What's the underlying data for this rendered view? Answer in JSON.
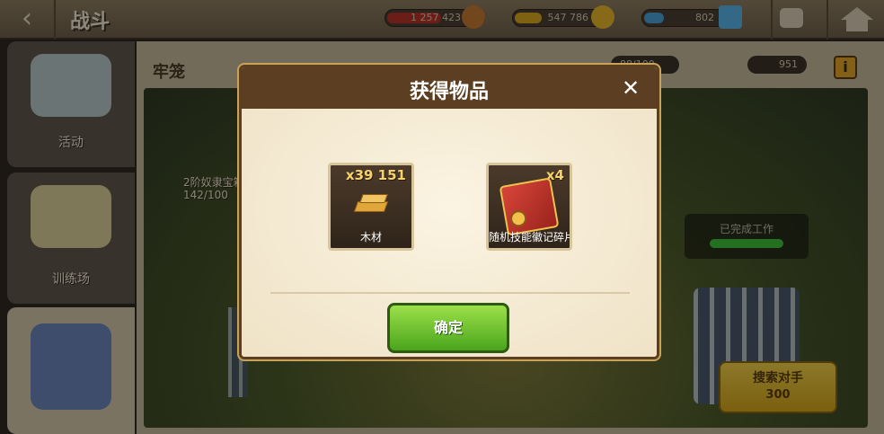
{
  "topbar": {
    "title": "战斗",
    "resources": [
      {
        "name": "meat",
        "value": "1 257 423",
        "color": "#b8322a",
        "icon": "meat-icon"
      },
      {
        "name": "gold",
        "value": "547 786",
        "color": "#d9a91f",
        "icon": "gold-coin-icon"
      },
      {
        "name": "gems",
        "value": "802",
        "color": "#4aa0d8",
        "icon": "gem-icon"
      }
    ]
  },
  "sidebar": {
    "items": [
      {
        "label": "活动",
        "icon": "event-icon"
      },
      {
        "label": "训练场",
        "icon": "training-icon"
      },
      {
        "label": "",
        "icon": "prison-icon"
      }
    ]
  },
  "main": {
    "title": "牢笼",
    "badge_left": "88/100",
    "badge_right": "951",
    "event_title": "2阶奴隶宝箱",
    "event_count": "142/100",
    "done_label": "已完成工作",
    "search_label": "搜索对手",
    "search_cost": "300"
  },
  "modal": {
    "title": "获得物品",
    "close_label": "✕",
    "items": [
      {
        "qty": "x39 151",
        "name": "木材",
        "icon": "wood-icon"
      },
      {
        "qty": "x4",
        "name": "随机技能徽记碎片",
        "icon": "skill-book-icon"
      }
    ],
    "confirm_label": "确定"
  }
}
